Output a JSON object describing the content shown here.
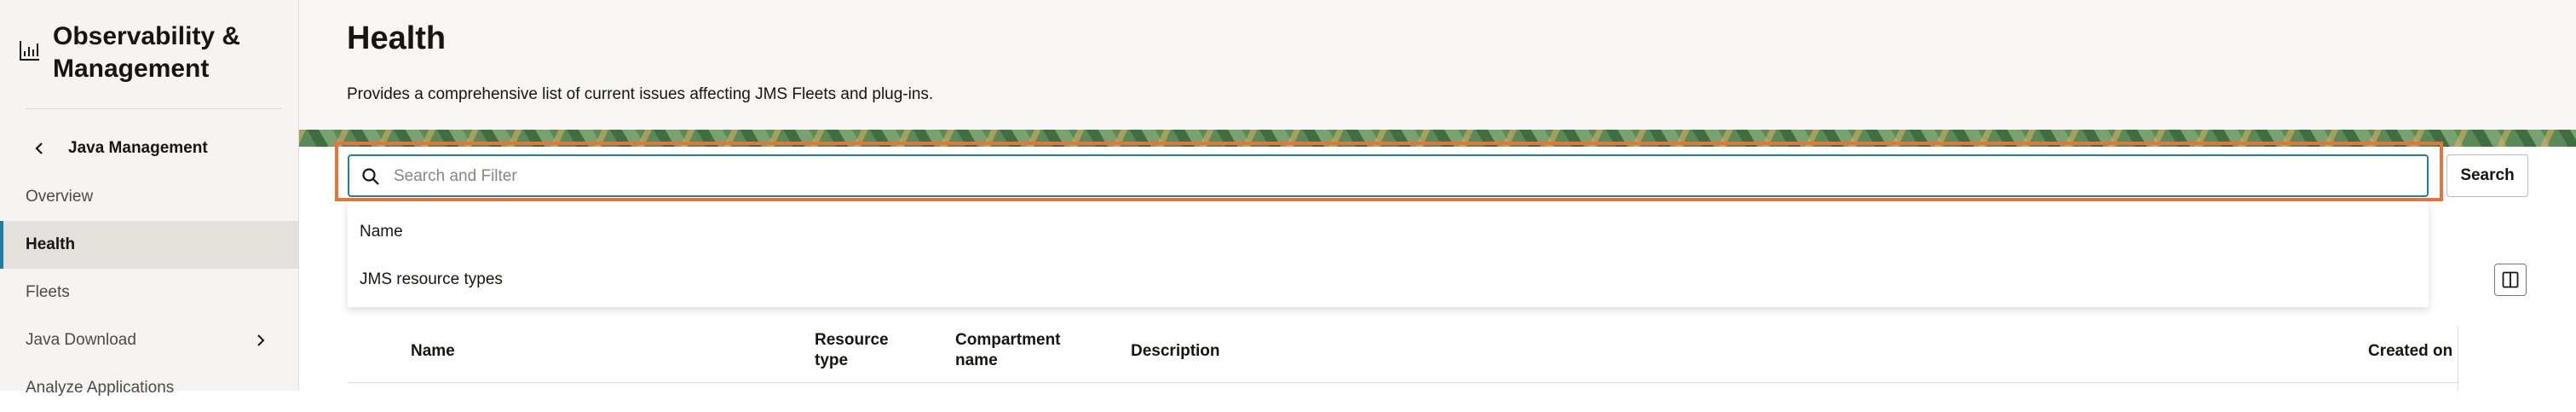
{
  "sidebar": {
    "app_title": "Observability & Management",
    "back_label": "Java Management",
    "items": [
      {
        "label": "Overview"
      },
      {
        "label": "Health"
      },
      {
        "label": "Fleets"
      },
      {
        "label": "Java Download"
      },
      {
        "label": "Analyze Applications"
      }
    ]
  },
  "header": {
    "title": "Health",
    "description": "Provides a comprehensive list of current issues affecting JMS Fleets and plug-ins."
  },
  "search": {
    "placeholder": "Search and Filter",
    "value": "",
    "button_label": "Search",
    "options": [
      {
        "label": "Name"
      },
      {
        "label": "JMS resource types"
      }
    ]
  },
  "table": {
    "columns": [
      {
        "label": "Name"
      },
      {
        "label": "Resource type"
      },
      {
        "label": "Compartment name"
      },
      {
        "label": "Description"
      },
      {
        "label": "Created on"
      }
    ]
  },
  "colors": {
    "accent": "#227e9e",
    "focus_ring": "#e8743b",
    "sidebar_bg": "#f5f4f2",
    "active_bg": "#e4e1dd"
  },
  "icons": {
    "brand": "chart-icon",
    "back": "chevron-left-icon",
    "search": "search-icon",
    "expand": "chevron-right-icon",
    "columns": "columns-icon"
  }
}
